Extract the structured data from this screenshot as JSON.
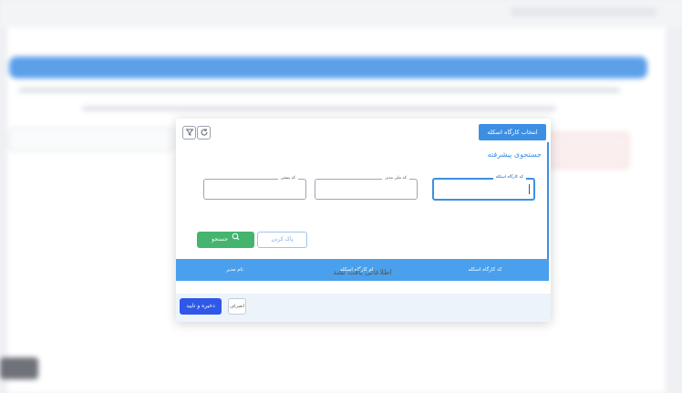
{
  "dialog": {
    "title": "انتخاب کارگاه اسکله",
    "toolbar": {
      "refresh_icon": "refresh-icon",
      "filter_icon": "filter-clear-icon"
    },
    "advanced_search": {
      "title": "جستجوی پیشرفته",
      "fields": {
        "workshop_code": {
          "label": "کد کارگاه اسکله",
          "value": ""
        },
        "manager_national_id": {
          "label": "کد ملی مدیر",
          "value": ""
        },
        "postal_code": {
          "label": "کد پستی",
          "value": ""
        }
      },
      "clear_label": "پاک کردن",
      "search_label": "جستجو"
    },
    "grid": {
      "columns": [
        "کد کارگاه اسکله",
        "نام کارگاه اسکله",
        "نام مدیر"
      ],
      "empty_message": "اطلاعاتی یافت نشد"
    },
    "footer": {
      "confirm_label": "ذخیره و تایید",
      "cancel_label": "انصراف"
    }
  },
  "colors": {
    "accent": "#3d8fe3",
    "grid_header": "#4aa0ec",
    "search_button": "#45b46e",
    "confirm_button": "#2f57e8"
  }
}
